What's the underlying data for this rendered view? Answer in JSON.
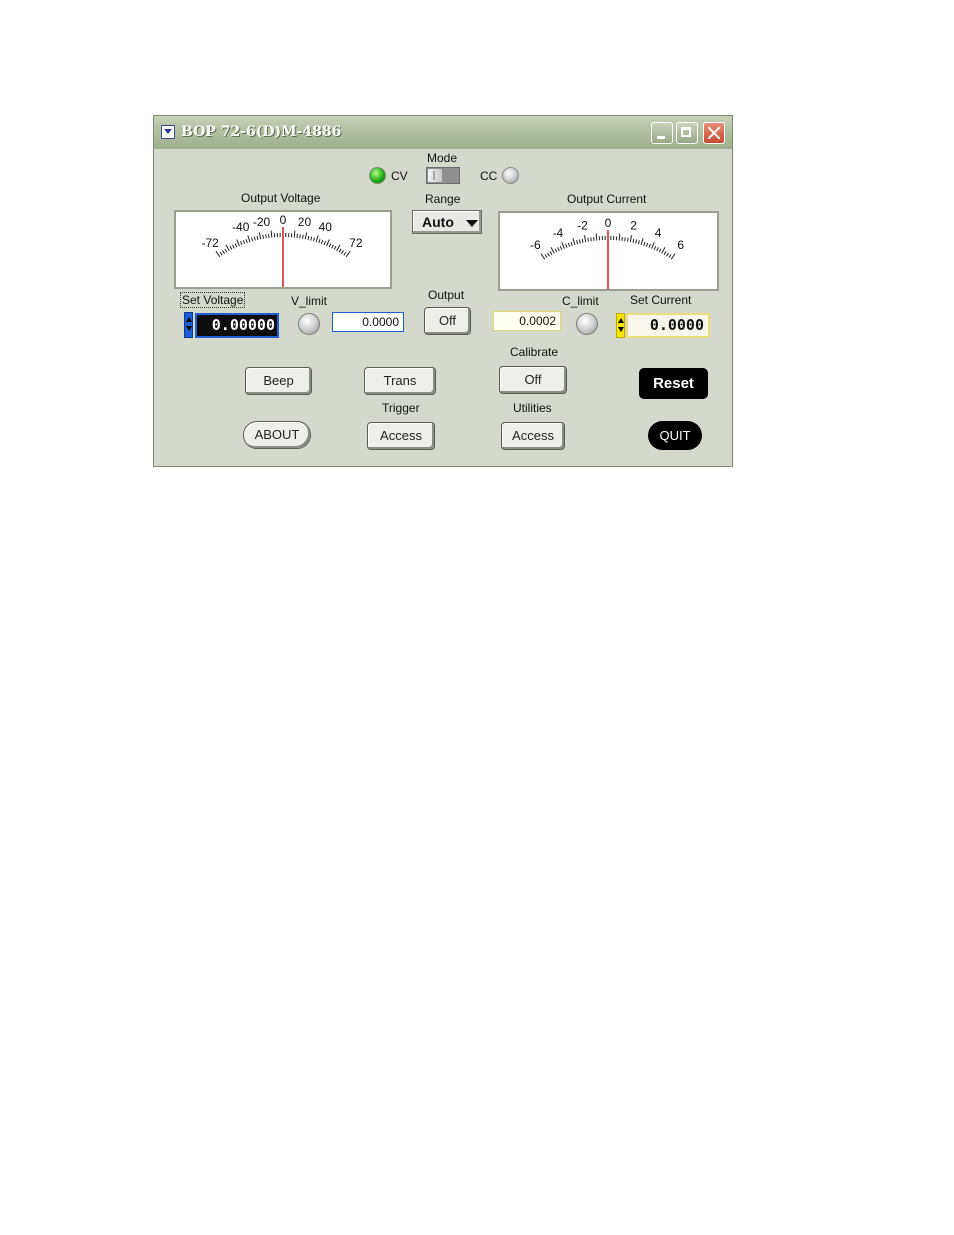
{
  "window": {
    "title": "BOP 72-6(D)M-4886"
  },
  "mode": {
    "label": "Mode",
    "cv_label": "CV",
    "cc_label": "CC",
    "cv_active": true,
    "cc_active": false
  },
  "range": {
    "label": "Range",
    "selected": "Auto"
  },
  "voltage_meter": {
    "title": "Output Voltage",
    "ticks": [
      "-72",
      "-40",
      "-20",
      "0",
      "20",
      "40",
      "72"
    ],
    "min": -72,
    "max": 72,
    "value": 0
  },
  "current_meter": {
    "title": "Output Current",
    "ticks": [
      "-6",
      "-4",
      "-2",
      "0",
      "2",
      "4",
      "6"
    ],
    "min": -6,
    "max": 6,
    "value": 0
  },
  "controls": {
    "set_voltage_label": "Set Voltage",
    "set_voltage_value": "0.00000",
    "v_limit_label": "V_limit",
    "v_limit_value": "0.0000",
    "output_label": "Output",
    "output_button": "Off",
    "c_limit_label": "C_limit",
    "c_limit_value": "0.0002",
    "set_current_label": "Set Current",
    "set_current_value": "0.0000"
  },
  "buttons": {
    "calibrate_label": "Calibrate",
    "calibrate_button": "Off",
    "beep": "Beep",
    "trans": "Trans",
    "reset": "Reset",
    "trigger_label": "Trigger",
    "trigger_button": "Access",
    "utilities_label": "Utilities",
    "utilities_button": "Access",
    "about": "ABOUT",
    "quit": "QUIT"
  },
  "colors": {
    "needle": "#cc2020",
    "set_voltage_accent": "#1f5fd6",
    "set_current_accent": "#f4e600"
  }
}
